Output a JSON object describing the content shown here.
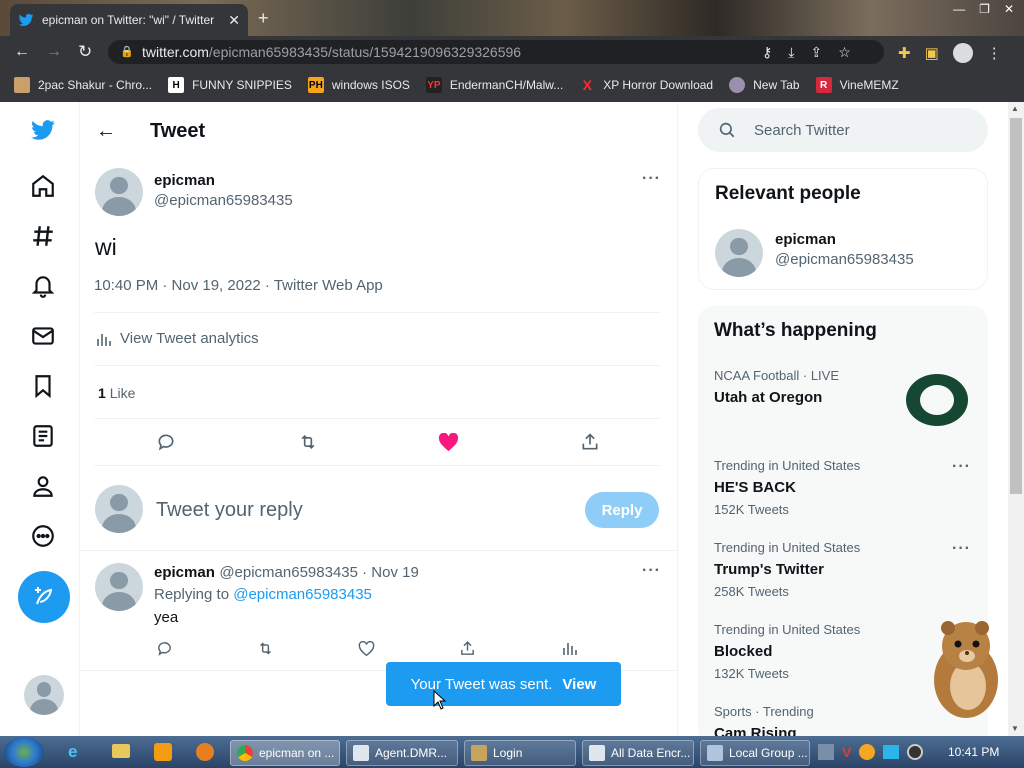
{
  "browser": {
    "tab_title": "epicman on Twitter: \"wi\" / Twitter",
    "url_host": "twitter.com",
    "url_path": "/epicman65983435/status/1594219096329326596",
    "bookmarks": [
      {
        "label": "2pac Shakur - Chro..."
      },
      {
        "label": "FUNNY SNIPPIES"
      },
      {
        "label": "windows ISOS"
      },
      {
        "label": "EndermanCH/Malw..."
      },
      {
        "label": "XP Horror Download"
      },
      {
        "label": "New Tab"
      },
      {
        "label": "VineMEMZ"
      }
    ]
  },
  "header": {
    "title": "Tweet"
  },
  "tweet": {
    "name": "epicman",
    "handle": "@epicman65983435",
    "text": "wi",
    "meta": "10:40 PM · Nov 19, 2022 · Twitter Web App",
    "analytics": "View Tweet analytics",
    "likes_count": "1",
    "likes_label": "Like"
  },
  "reply_box": {
    "placeholder": "Tweet your reply",
    "button": "Reply"
  },
  "reply": {
    "name": "epicman",
    "handle_date": "@epicman65983435 · Nov 19",
    "replying_prefix": "Replying to",
    "replying_handle": "@epicman65983435",
    "text": "yea"
  },
  "sidebar": {
    "search_placeholder": "Search Twitter",
    "relevant_title": "Relevant people",
    "relevant_name": "epicman",
    "relevant_handle": "@epicman65983435",
    "happening_title": "What’s happening",
    "trends": [
      {
        "meta": "NCAA Football · LIVE",
        "title": "Utah at Oregon",
        "count": ""
      },
      {
        "meta": "Trending in United States",
        "title": "HE'S BACK",
        "count": "152K Tweets"
      },
      {
        "meta": "Trending in United States",
        "title": "Trump's Twitter",
        "count": "258K Tweets"
      },
      {
        "meta": "Trending in United States",
        "title": "Blocked",
        "count": "132K Tweets"
      },
      {
        "meta": "Sports · Trending",
        "title": "Cam Rising",
        "count": ""
      }
    ]
  },
  "toast": {
    "message": "Your Tweet was sent.",
    "action": "View"
  },
  "taskbar": {
    "items": [
      {
        "label": "epicman on ..."
      },
      {
        "label": "Agent.DMR..."
      },
      {
        "label": "Login"
      },
      {
        "label": "All Data Encr..."
      },
      {
        "label": "Local Group ..."
      }
    ],
    "clock": "10:41 PM"
  },
  "colors": {
    "twitter_blue": "#1d9bf0",
    "like_pink": "#f91880",
    "oregon_green": "#154733"
  }
}
